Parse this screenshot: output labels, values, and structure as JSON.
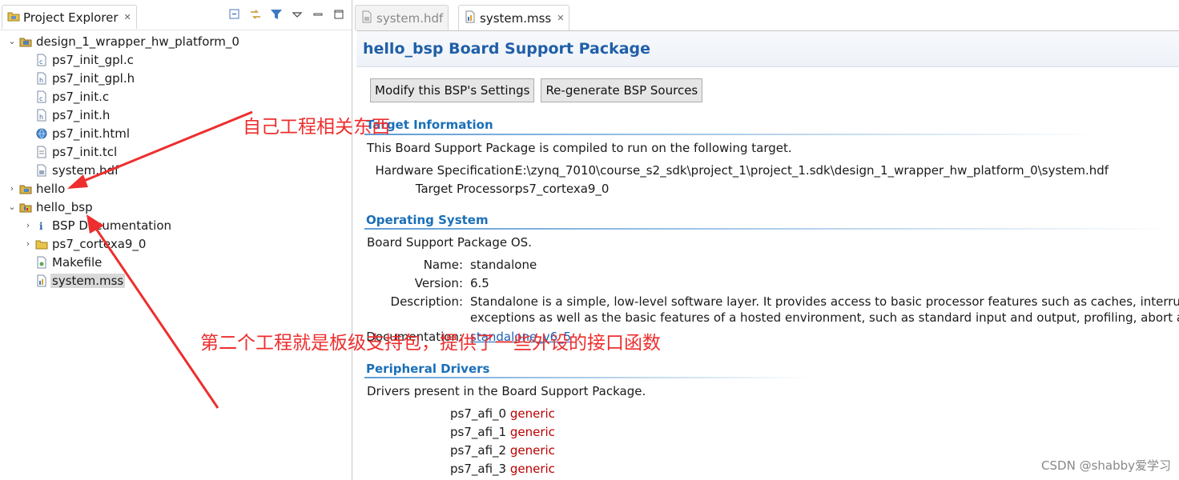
{
  "project_explorer": {
    "tab_label": "Project Explorer",
    "close_glyph": "✕",
    "toolbar_icons": [
      "collapse-all-icon",
      "link-with-editor-icon",
      "filter-icon",
      "view-menu-icon",
      "minimize-icon",
      "maximize-icon"
    ],
    "tree": [
      {
        "label": "design_1_wrapper_hw_platform_0",
        "depth": 0,
        "arrow": "⌄",
        "icon": "hw-platform-project-icon"
      },
      {
        "label": "ps7_init_gpl.c",
        "depth": 1,
        "arrow": "",
        "icon": "c-file-icon"
      },
      {
        "label": "ps7_init_gpl.h",
        "depth": 1,
        "arrow": "",
        "icon": "h-file-icon"
      },
      {
        "label": "ps7_init.c",
        "depth": 1,
        "arrow": "",
        "icon": "c-file-icon"
      },
      {
        "label": "ps7_init.h",
        "depth": 1,
        "arrow": "",
        "icon": "h-file-icon"
      },
      {
        "label": "ps7_init.html",
        "depth": 1,
        "arrow": "",
        "icon": "html-file-icon"
      },
      {
        "label": "ps7_init.tcl",
        "depth": 1,
        "arrow": "",
        "icon": "tcl-file-icon"
      },
      {
        "label": "system.hdf",
        "depth": 1,
        "arrow": "",
        "icon": "hdf-file-icon"
      },
      {
        "label": "hello",
        "depth": 0,
        "arrow": "›",
        "icon": "application-project-icon"
      },
      {
        "label": "hello_bsp",
        "depth": 0,
        "arrow": "⌄",
        "icon": "bsp-project-icon"
      },
      {
        "label": "BSP Documentation",
        "depth": 1,
        "arrow": "›",
        "icon": "info-icon"
      },
      {
        "label": "ps7_cortexa9_0",
        "depth": 1,
        "arrow": "›",
        "icon": "folder-icon"
      },
      {
        "label": "Makefile",
        "depth": 1,
        "arrow": "",
        "icon": "makefile-icon"
      },
      {
        "label": "system.mss",
        "depth": 1,
        "arrow": "",
        "icon": "mss-file-icon",
        "selected": true
      }
    ]
  },
  "editor": {
    "tabs": [
      {
        "label": "system.hdf",
        "active": false,
        "icon": "hdf-file-icon"
      },
      {
        "label": "system.mss",
        "active": true,
        "icon": "mss-file-icon",
        "close": "✕"
      }
    ],
    "form_title": "hello_bsp Board Support Package",
    "buttons": {
      "modify": "Modify this BSP's Settings",
      "regenerate": "Re-generate BSP Sources"
    },
    "target": {
      "heading": "Target Information",
      "intro": "This Board Support Package is compiled to run on the following target.",
      "hw_spec_key": "Hardware Specification:",
      "hw_spec_val": "E:\\zynq_7010\\course_s2_sdk\\project_1\\project_1.sdk\\design_1_wrapper_hw_platform_0\\system.hdf",
      "proc_key": "Target Processor:",
      "proc_val": "ps7_cortexa9_0"
    },
    "os": {
      "heading": "Operating System",
      "intro": "Board Support Package OS.",
      "name_key": "Name:",
      "name_val": "standalone",
      "version_key": "Version:",
      "version_val": "6.5",
      "desc_key": "Description:",
      "desc_line1": "Standalone is a simple, low-level software layer. It provides access to basic processor features such as caches, interrupts and",
      "desc_line2": "exceptions as well as the basic features of a hosted environment, such as standard input and output, profiling, abort and exit.",
      "doc_key": "Documentation:",
      "doc_link": "standalone_v6_5"
    },
    "drivers": {
      "heading": "Peripheral Drivers",
      "intro": "Drivers present in the Board Support Package.",
      "items": [
        {
          "name": "ps7_afi_0",
          "driver": "generic"
        },
        {
          "name": "ps7_afi_1",
          "driver": "generic"
        },
        {
          "name": "ps7_afi_2",
          "driver": "generic"
        },
        {
          "name": "ps7_afi_3",
          "driver": "generic"
        }
      ]
    }
  },
  "annotations": {
    "note1": "自己工程相关东西",
    "note2": "第二个工程就是板级支持包，提供了一些外设的接口函数",
    "color": "#ee2e2e"
  },
  "watermark": "CSDN @shabby爱学习"
}
